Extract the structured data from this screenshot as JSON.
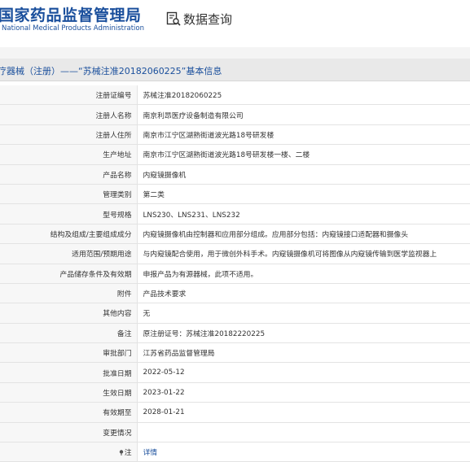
{
  "header": {
    "logo_cn": "国家药品监督管理局",
    "logo_en": "National Medical Products Administration",
    "query_label": "数据查询"
  },
  "page_title": "疗器械（注册）——“苏械注准20182060225”基本信息",
  "rows": [
    {
      "label": "注册证编号",
      "value": "苏械注准20182060225"
    },
    {
      "label": "注册人名称",
      "value": "南京利昂医疗设备制造有限公司"
    },
    {
      "label": "注册人住所",
      "value": "南京市江宁区湖熟街道波光路18号研发楼"
    },
    {
      "label": "生产地址",
      "value": "南京市江宁区湖熟街道波光路18号研发楼一楼、二楼"
    },
    {
      "label": "产品名称",
      "value": "内窥镜摄像机"
    },
    {
      "label": "管理类别",
      "value": "第二类"
    },
    {
      "label": "型号规格",
      "value": "LNS230、LNS231、LNS232"
    },
    {
      "label": "结构及组成/主要组成成分",
      "value": "内窥镜摄像机由控制器和应用部分组成。应用部分包括：内窥镜接口适配器和摄像头"
    },
    {
      "label": "适用范围/预期用途",
      "value": "与内窥镜配合使用，用于微创外科手术。内窥镜摄像机可将图像从内窥镜传输到医学监视器上"
    },
    {
      "label": "产品储存条件及有效期",
      "value": "申报产品为有源器械，此项不适用。"
    },
    {
      "label": "附件",
      "value": "产品技术要求"
    },
    {
      "label": "其他内容",
      "value": "无"
    },
    {
      "label": "备注",
      "value": "原注册证号：苏械注准20182220225"
    },
    {
      "label": "审批部门",
      "value": "江苏省药品监督管理局"
    },
    {
      "label": "批准日期",
      "value": "2022-05-12"
    },
    {
      "label": "生效日期",
      "value": "2023-01-22"
    },
    {
      "label": "有效期至",
      "value": "2028-01-21"
    },
    {
      "label": "变更情况",
      "value": ""
    }
  ],
  "note_row": {
    "label": "注",
    "link": "详情"
  },
  "colors": {
    "brand": "#1a4f9c",
    "label_bg": "#f7f7f7",
    "title_bar_bg": "#e9e9e9"
  }
}
